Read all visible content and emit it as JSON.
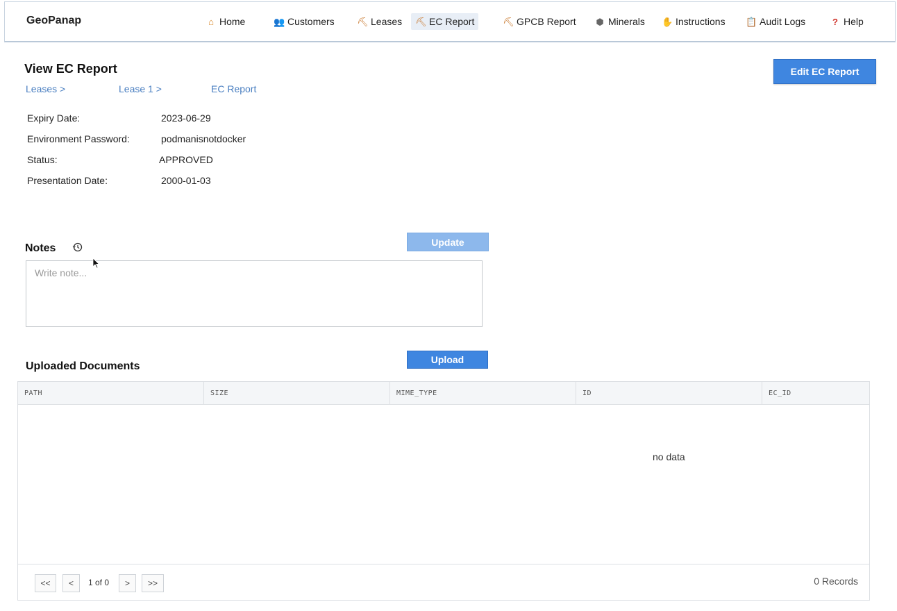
{
  "brand": "GeoPanap",
  "nav": [
    {
      "label": "Home",
      "icon": "home-icon",
      "glyph": "⌂"
    },
    {
      "label": "Customers",
      "icon": "people-icon",
      "glyph": "👥"
    },
    {
      "label": "Leases",
      "icon": "crane-icon",
      "glyph": "⛏"
    },
    {
      "label": "EC Report",
      "icon": "crane-icon",
      "glyph": "⛏"
    },
    {
      "label": "GPCB Report",
      "icon": "crane-icon",
      "glyph": "⛏"
    },
    {
      "label": "Minerals",
      "icon": "rock-icon",
      "glyph": "⬢"
    },
    {
      "label": "Instructions",
      "icon": "handshake-icon",
      "glyph": "✋"
    },
    {
      "label": "Audit Logs",
      "icon": "clipboard-icon",
      "glyph": "📋"
    },
    {
      "label": "Help",
      "icon": "question-icon",
      "glyph": "?"
    }
  ],
  "active_nav": "EC Report",
  "page": {
    "title": "View EC Report",
    "edit_button": "Edit EC Report"
  },
  "breadcrumb": [
    "Leases >",
    "Lease 1 >",
    "EC Report"
  ],
  "details": [
    {
      "label": "Expiry Date:",
      "value": "2023-06-29"
    },
    {
      "label": "Environment Password:",
      "value": "podmanisnotdocker"
    },
    {
      "label": "Status:",
      "value": "APPROVED"
    },
    {
      "label": "Presentation Date:",
      "value": "2000-01-03"
    }
  ],
  "notes": {
    "heading": "Notes",
    "update_button": "Update",
    "placeholder": "Write note..."
  },
  "documents": {
    "heading": "Uploaded Documents",
    "upload_button": "Upload",
    "columns": [
      "PATH",
      "SIZE",
      "MIME_TYPE",
      "ID",
      "EC_ID"
    ],
    "rows": [],
    "empty_text": "no data",
    "pagination": {
      "first": "<<",
      "prev": "<",
      "info": "1 of 0",
      "next": ">",
      "last": ">>"
    },
    "records": "0 Records"
  },
  "colors": {
    "accent": "#3f86e0",
    "accent_disabled": "#8db8ec",
    "link": "#4a7fc1"
  }
}
